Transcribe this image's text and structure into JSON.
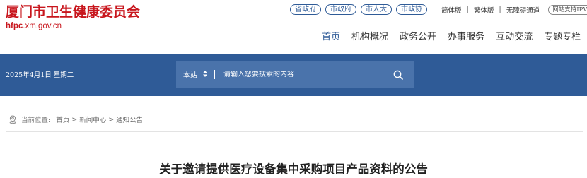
{
  "site": {
    "title": "厦门市卫生健康委员会",
    "domain_prefix": "hfpc",
    "domain_suffix": ".xm.gov.cn"
  },
  "top_links": {
    "pills": [
      "省政府",
      "市政府",
      "市人大",
      "市政协"
    ],
    "simplified": "简体版",
    "traditional": "繁体版",
    "accessible": "无障碍通道",
    "ipv6": "网站支持IPV6"
  },
  "main_nav": {
    "items": [
      "首页",
      "机构概况",
      "政务公开",
      "办事服务",
      "互动交流",
      "专题专栏"
    ],
    "active_index": 0
  },
  "band": {
    "date": "2025年4月1日 星期二"
  },
  "search": {
    "scope": "本站",
    "placeholder": "请输入您要搜索的内容"
  },
  "breadcrumb": {
    "label": "当前位置:",
    "items": [
      "首页",
      "新闻中心",
      "通知公告"
    ]
  },
  "article": {
    "title": "关于邀请提供医疗设备集中采购项目产品资料的公告"
  },
  "colors": {
    "brand_red": "#c8161d",
    "brand_blue": "#2f5b97"
  },
  "icons": {
    "search": "search-icon",
    "location": "location-icon",
    "dropdown": "chevron-updown-icon"
  }
}
